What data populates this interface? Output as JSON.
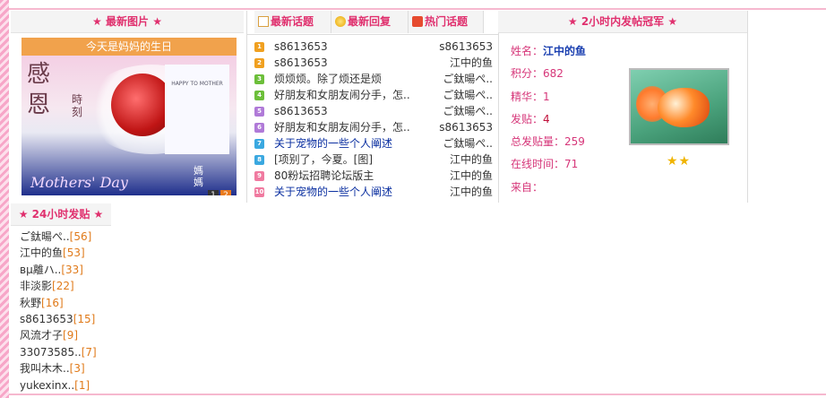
{
  "latest_pictures": {
    "title": "最新图片",
    "photo": {
      "caption": "今天是妈妈的生日",
      "kanji": "感恩",
      "kanji_sub": "時刻",
      "card_heading": "HAPPY TO MOTHER",
      "mothers_text": "Mothers' Day",
      "mama_text": "媽媽",
      "pages": [
        "1",
        "2"
      ]
    }
  },
  "topics": {
    "tabs": [
      {
        "label": "最新话题",
        "icon": "document-icon"
      },
      {
        "label": "最新回复",
        "icon": "lightbulb-icon"
      },
      {
        "label": "热门话题",
        "icon": "hot-icon"
      }
    ],
    "items": [
      {
        "num": "1",
        "title": "s8613653",
        "author": "s8613653",
        "color": "#f0a020",
        "link": false
      },
      {
        "num": "2",
        "title": "s8613653",
        "author": "江中的鱼",
        "color": "#f0a020",
        "link": false
      },
      {
        "num": "3",
        "title": "烦烦烦。除了烦还是烦",
        "author": "ご鈦暘ぺ..",
        "color": "#6cbf3a",
        "link": false
      },
      {
        "num": "4",
        "title": "好朋友和女朋友闹分手，怎..",
        "author": "ご鈦暘ぺ..",
        "color": "#6cbf3a",
        "link": false
      },
      {
        "num": "5",
        "title": "s8613653",
        "author": "ご鈦暘ぺ..",
        "color": "#b07ad8",
        "link": false
      },
      {
        "num": "6",
        "title": "好朋友和女朋友闹分手，怎..",
        "author": "s8613653",
        "color": "#b07ad8",
        "link": false
      },
      {
        "num": "7",
        "title": "关于宠物的一些个人阐述",
        "author": "ご鈦暘ぺ..",
        "color": "#3aa8e0",
        "link": true
      },
      {
        "num": "8",
        "title": "[项别了，今夏。[图]",
        "author": "江中的鱼",
        "color": "#3aa8e0",
        "link": false
      },
      {
        "num": "9",
        "title": "80粉坛招聘论坛版主",
        "author": "江中的鱼",
        "color": "#f07aa0",
        "link": false
      },
      {
        "num": "10",
        "title": "关于宠物的一些个人阐述",
        "author": "江中的鱼",
        "color": "#f07aa0",
        "link": true
      }
    ]
  },
  "champion": {
    "title": "2小时内发帖冠军",
    "fields": [
      {
        "label": "姓名：",
        "value": "江中的鱼",
        "style": "blue"
      },
      {
        "label": "积分：",
        "value": "682",
        "style": ""
      },
      {
        "label": "精华：",
        "value": "1",
        "style": ""
      },
      {
        "label": "发贴：",
        "value": "4",
        "style": "red"
      },
      {
        "label": "总发贴量：",
        "value": "259",
        "style": ""
      },
      {
        "label": "在线时间：",
        "value": "71",
        "style": ""
      },
      {
        "label": "来自：",
        "value": "",
        "style": ""
      }
    ],
    "stars": "★★"
  },
  "posts_24h": {
    "title": "24小时发贴",
    "items": [
      {
        "name": "ご鈦暘ぺ..",
        "count": "[56]"
      },
      {
        "name": "江中的鱼",
        "count": "[53]"
      },
      {
        "name": "вμ離ハ..",
        "count": "[33]"
      },
      {
        "name": "非淡影",
        "count": "[22]"
      },
      {
        "name": "秋野",
        "count": "[16]"
      },
      {
        "name": "s8613653",
        "count": "[15]"
      },
      {
        "name": "风流才子",
        "count": "[9]"
      },
      {
        "name": "33073585..",
        "count": "[7]"
      },
      {
        "name": "我叫木木..",
        "count": "[3]"
      },
      {
        "name": "yukexinx..",
        "count": "[1]"
      }
    ]
  }
}
